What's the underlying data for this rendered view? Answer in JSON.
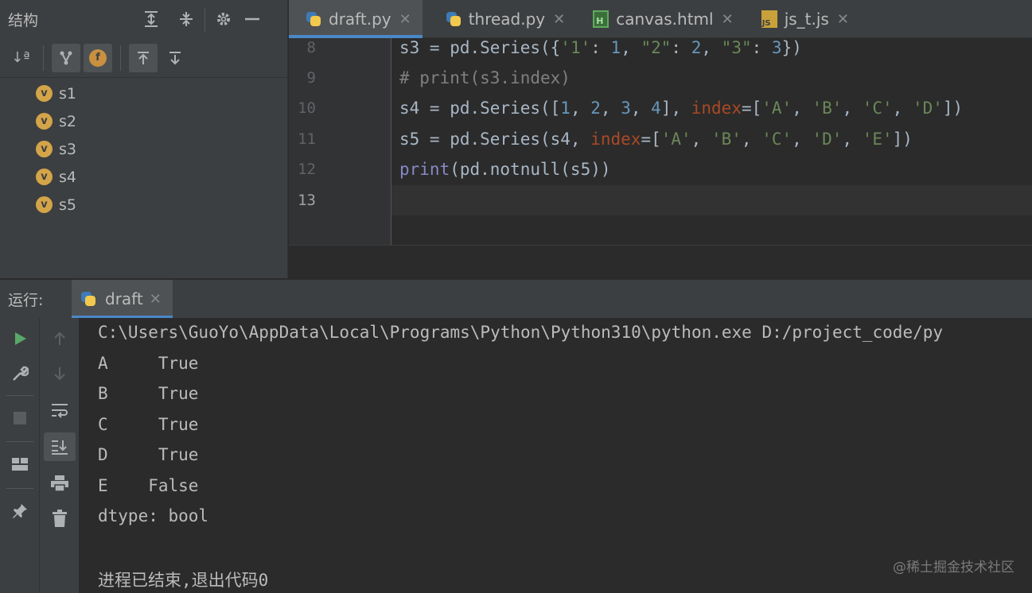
{
  "structure": {
    "title": "结构",
    "items": [
      {
        "badge": "v",
        "label": "s1"
      },
      {
        "badge": "v",
        "label": "s2"
      },
      {
        "badge": "v",
        "label": "s3"
      },
      {
        "badge": "v",
        "label": "s4"
      },
      {
        "badge": "v",
        "label": "s5"
      }
    ],
    "toolbar": {
      "sort_label": "↓ª",
      "field_badge": "f"
    }
  },
  "tabs": [
    {
      "label": "draft.py",
      "icon": "python-icon",
      "active": true
    },
    {
      "label": "thread.py",
      "icon": "python-icon",
      "active": false
    },
    {
      "label": "canvas.html",
      "icon": "html-icon",
      "active": false
    },
    {
      "label": "js_t.js",
      "icon": "js-icon",
      "active": false
    }
  ],
  "editor": {
    "line_numbers": [
      "8",
      "9",
      "10",
      "11",
      "12",
      "13"
    ],
    "current_line": "13"
  },
  "run": {
    "title": "运行:",
    "tab_label": "draft",
    "output": [
      "C:\\Users\\GuoYo\\AppData\\Local\\Programs\\Python\\Python310\\python.exe D:/project_code/py",
      "A     True",
      "B     True",
      "C     True",
      "D     True",
      "E    False",
      "dtype: bool",
      "",
      "进程已结束,退出代码0"
    ]
  },
  "watermark": "@稀土掘金技术社区"
}
